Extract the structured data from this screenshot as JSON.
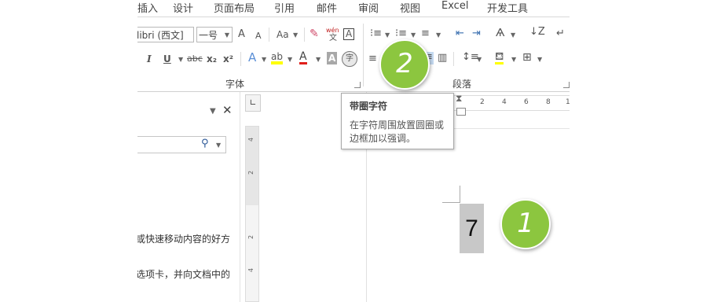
{
  "ribbon": {
    "tabs": [
      "插入",
      "设计",
      "页面布局",
      "引用",
      "邮件",
      "审阅",
      "视图",
      "Excel",
      "开发工具"
    ],
    "font_group": {
      "font_name": "libri (西文]",
      "font_size": "一号",
      "grow_font": "A",
      "shrink_font": "A",
      "change_case": "Aa",
      "clear_format": "✎",
      "phonetic": "wén",
      "char_border": "A",
      "italic": "I",
      "underline": "U",
      "strikethrough": "abc",
      "subscript": "x₂",
      "superscript": "x²",
      "text_effect": "A",
      "highlight": "ab",
      "font_color": "A",
      "char_shading": "A",
      "enclose": "字",
      "label": "字体"
    },
    "paragraph_group": {
      "label": "段落"
    }
  },
  "tooltip": {
    "title": "带圈字符",
    "description_line1": "在字符周围放置圆圈或",
    "description_line2": "边框加以强调。"
  },
  "badges": {
    "one": "1",
    "two": "2"
  },
  "nav_pane": {
    "text1": "或快速移动内容的好方",
    "text2": "选项卡，并向文档中的",
    "close": "✕"
  },
  "document": {
    "char": "7"
  },
  "ruler": {
    "horizontal": [
      "2",
      "4",
      "6",
      "8",
      "1"
    ],
    "vertical": [
      "4",
      "2",
      "2",
      "4"
    ]
  },
  "colors": {
    "badge_green": "#8cc63f",
    "highlight_yellow": "#ffff00",
    "font_red": "#e0201b",
    "char_shading_gray": "#c8c8c8"
  }
}
